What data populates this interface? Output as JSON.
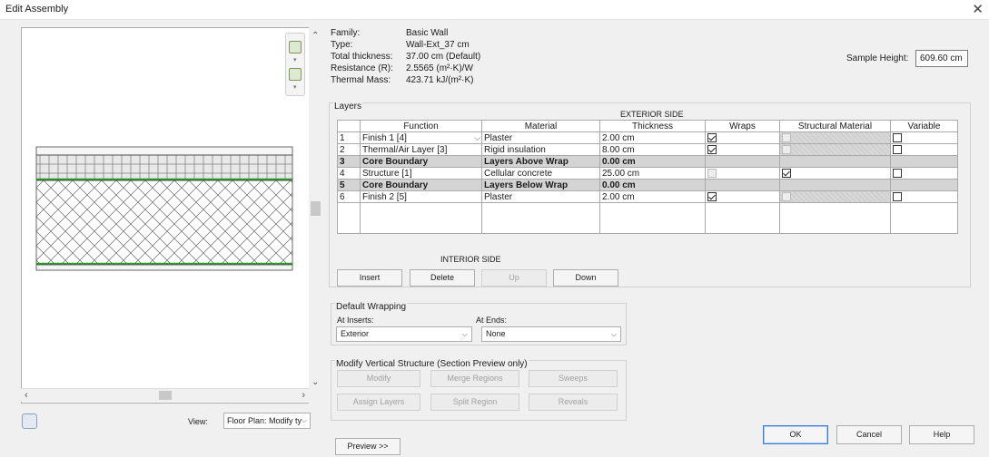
{
  "window": {
    "title": "Edit Assembly"
  },
  "properties": [
    {
      "label": "Family:",
      "value": "Basic Wall"
    },
    {
      "label": "Type:",
      "value": "Wall-Ext_37 cm"
    },
    {
      "label": "Total thickness:",
      "value": "37.00 cm (Default)"
    },
    {
      "label": "Resistance (R):",
      "value": "2.5565 (m²·K)/W"
    },
    {
      "label": "Thermal Mass:",
      "value": "423.71 kJ/(m²·K)"
    }
  ],
  "sample_height": {
    "label": "Sample Height:",
    "value": "609.60 cm"
  },
  "layers": {
    "caption": "Layers",
    "exterior_side": "EXTERIOR SIDE",
    "interior_side": "INTERIOR SIDE",
    "columns": [
      "Function",
      "Material",
      "Thickness",
      "Wraps",
      "Structural Material",
      "Variable"
    ],
    "rows": [
      {
        "num": "1",
        "function": "Finish 1 [4]",
        "material": "Plaster",
        "thickness": "2.00 cm",
        "wraps": true,
        "structural": false,
        "variable": false,
        "core": false
      },
      {
        "num": "2",
        "function": "Thermal/Air Layer [3]",
        "material": "Rigid insulation",
        "thickness": "8.00 cm",
        "wraps": true,
        "structural": false,
        "variable": false,
        "core": false
      },
      {
        "num": "3",
        "function": "Core Boundary",
        "material": "Layers Above Wrap",
        "thickness": "0.00 cm",
        "core": true
      },
      {
        "num": "4",
        "function": "Structure [1]",
        "material": "Cellular concrete",
        "thickness": "25.00 cm",
        "wraps": false,
        "structural": true,
        "variable": false,
        "core": false
      },
      {
        "num": "5",
        "function": "Core Boundary",
        "material": "Layers Below Wrap",
        "thickness": "0.00 cm",
        "core": true
      },
      {
        "num": "6",
        "function": "Finish 2 [5]",
        "material": "Plaster",
        "thickness": "2.00 cm",
        "wraps": true,
        "structural": false,
        "variable": false,
        "core": false
      }
    ]
  },
  "layer_buttons": {
    "insert": "Insert",
    "delete": "Delete",
    "up": "Up",
    "down": "Down"
  },
  "default_wrapping": {
    "caption": "Default Wrapping",
    "at_inserts_label": "At Inserts:",
    "at_inserts_value": "Exterior",
    "at_ends_label": "At Ends:",
    "at_ends_value": "None"
  },
  "modify_vertical": {
    "caption": "Modify Vertical Structure (Section Preview only)",
    "modify": "Modify",
    "merge_regions": "Merge Regions",
    "sweeps": "Sweeps",
    "assign_layers": "Assign Layers",
    "split_region": "Split Region",
    "reveals": "Reveals"
  },
  "view": {
    "label": "View:",
    "value": "Floor Plan: Modify ty"
  },
  "footer": {
    "preview": "Preview >>",
    "ok": "OK",
    "cancel": "Cancel",
    "help": "Help"
  },
  "colors": {
    "core_line": "#2a9a2a",
    "core_row": "#d4d4d4",
    "accent": "#3a7bd5"
  }
}
